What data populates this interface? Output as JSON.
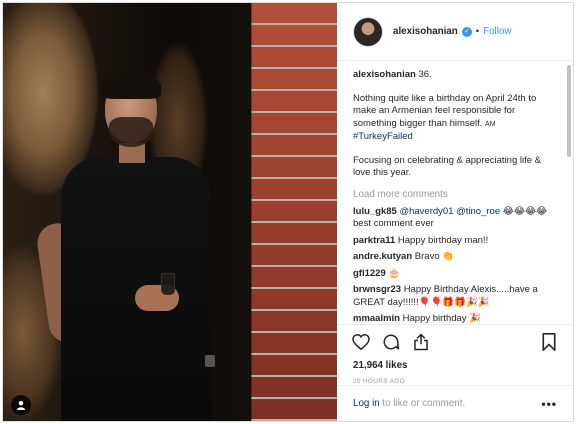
{
  "header": {
    "username": "alexisohanian",
    "separator": "•",
    "follow_label": "Follow",
    "verified_glyph": "✓"
  },
  "caption": {
    "username": "alexisohanian",
    "line1": "36.",
    "para2": "Nothing quite like a birthday on April 24th to make an Armenian feel responsible for something bigger than himself. ",
    "para2_tail": "AM",
    "hashtag": "#TurkeyFailed",
    "para3": "Focusing on celebrating & appreciating life & love this year."
  },
  "load_more_label": "Load more comments",
  "comments": [
    {
      "user": "lulu_gk85",
      "mention1": "@haverdy01",
      "mention2": "@tino_roe",
      "text": " 😂😂😂😂 best comment ever"
    },
    {
      "user": "parktra11",
      "text": "Happy birthday man!!"
    },
    {
      "user": "andre.kutyan",
      "text": "Bravo 👏"
    },
    {
      "user": "gfl1229",
      "text": "🎂"
    },
    {
      "user": "brwnsgr23",
      "text": "Happy Birthday Alexis.....have a GREAT day!!!!!!🎈🎈🎁🎁🎉🎉"
    },
    {
      "user": "mmaalmin",
      "text": "Happy birthday 🎉"
    }
  ],
  "likes_text": "21,964 likes",
  "timestamp": "20 HOURS AGO",
  "footer": {
    "login_label": "Log in",
    "rest_label": " to like or comment.",
    "more_label": "•••"
  },
  "icons": {
    "heart": "heart-icon",
    "comment": "comment-icon",
    "share": "share-icon",
    "bookmark": "bookmark-icon",
    "user_tag": "user-tag-icon"
  },
  "colors": {
    "link_blue": "#3897f0",
    "dark_link": "#003569",
    "muted": "#999999",
    "border": "#dbdbdb"
  }
}
